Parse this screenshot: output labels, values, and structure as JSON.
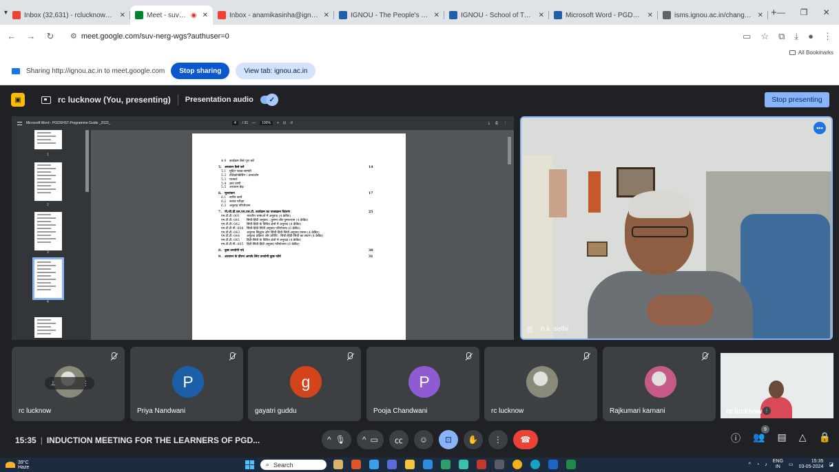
{
  "browser": {
    "tabs": [
      {
        "title": "Inbox (32,631) - rclucknow@ign",
        "icon": "gmail-icon",
        "color": "#ea4335",
        "active": false
      },
      {
        "title": "Meet - suv-nerg-wgs",
        "icon": "meet-icon",
        "color": "#00832d",
        "active": true
      },
      {
        "title": "Inbox - anamikasinha@ignou.ac",
        "icon": "gmail-icon",
        "color": "#ea4335",
        "active": false
      },
      {
        "title": "IGNOU - The People's Universit",
        "icon": "ignou-icon",
        "color": "#1e5fa8",
        "active": false
      },
      {
        "title": "IGNOU - School of Translation",
        "icon": "ignou-icon",
        "color": "#1e5fa8",
        "active": false
      },
      {
        "title": "Microsoft Word - PGDSHS",
        "icon": "ignou-icon",
        "color": "#1e5fa8",
        "active": false
      },
      {
        "title": "isms.ignou.ac.in/changeadmdet",
        "icon": "globe-icon",
        "color": "#5f6368",
        "active": false
      }
    ],
    "url": "meet.google.com/suv-nerg-wgs?authuser=0",
    "bookmarks_label": "All Bookmarks"
  },
  "share_banner": {
    "text": "Sharing http://ignou.ac.in to meet.google.com",
    "stop_label": "Stop sharing",
    "view_label": "View tab: ignou.ac.in"
  },
  "presenting": {
    "presenter": "rc lucknow (You, presenting)",
    "audio_label": "Presentation audio",
    "stop_label": "Stop presenting"
  },
  "document": {
    "title": "Microsoft Word - PGDSHST-Programme Guide _2022_",
    "page": "4",
    "pages": "/ 31",
    "zoom": "100%",
    "thumb_numbers": [
      "1",
      "2",
      "3",
      "4"
    ],
    "toc": [
      {
        "num": "4.9",
        "text": "कार्यक्रम कैसे पूरा करें",
        "page": "",
        "level": "sub"
      },
      {
        "num": "5.",
        "text": "अध्ययन कैसे करें",
        "page": "14",
        "level": "sec"
      },
      {
        "num": "5.1",
        "text": "मुद्रित पाठ्य-सामग्री",
        "page": "",
        "level": "sub"
      },
      {
        "num": "5.2",
        "text": "टेलिकॉन्फ्रेंसिंग / ज्ञानदर्शन",
        "page": "",
        "level": "sub"
      },
      {
        "num": "5.3",
        "text": "परामर्श",
        "page": "",
        "level": "sub"
      },
      {
        "num": "5.4",
        "text": "ज्ञान वाणी",
        "page": "",
        "level": "sub"
      },
      {
        "num": "5.5",
        "text": "अध्ययन केंद्र",
        "page": "",
        "level": "sub"
      },
      {
        "num": "6.",
        "text": "मूल्यांकन",
        "page": "17",
        "level": "sec"
      },
      {
        "num": "6.1",
        "text": "सत्रीय कार्य",
        "page": "",
        "level": "sub"
      },
      {
        "num": "6.2",
        "text": "सत्रांत परीक्षा",
        "page": "",
        "level": "sub"
      },
      {
        "num": "6.3",
        "text": "अनुवाद परियोजना",
        "page": "",
        "level": "sub"
      },
      {
        "num": "7.",
        "text": "पी.जी.डी.एस.एच.एस.टी. कार्यक्रम का पाठ्यक्रम विवरण",
        "page": "25",
        "level": "sec"
      },
      {
        "num": "एम.टी.टी.-001",
        "text": "भारतीय भाषाओं में अनुवाद (4 क्रेडिट)",
        "page": "",
        "level": "sub"
      },
      {
        "num": "एम.टी.टी.-041",
        "text": "सिंधी-हिंदी अनुवाद : तुलना और पुनरुत्थान (4 क्रेडिट)",
        "page": "",
        "level": "sub"
      },
      {
        "num": "एम.टी.टी.-042",
        "text": "सिंधी-हिंदी के विविध क्षेत्रों में अनुवाद (4 क्रेडिट)",
        "page": "",
        "level": "sub"
      },
      {
        "num": "एम.टी.टी.पी.-004",
        "text": "सिंधी-हिंदी-सिंधी अनुवाद परियोजना (6 क्रेडिट)",
        "page": "",
        "level": "sub"
      },
      {
        "num": "एम.टी.टी.-043",
        "text": "अनुवाद सिद्धांत और सिंधी-हिंदी-सिंधी अनुवाद प्रयास (4 क्रेडिट)",
        "page": "",
        "level": "sub"
      },
      {
        "num": "एम.टी.टी.-044",
        "text": "अनुवाद प्रक्रिया और प्रविधि : सिंधी-हिंदी-सिंधी का संदर्भ (4 क्रेडिट)",
        "page": "",
        "level": "sub"
      },
      {
        "num": "एम.टी.टी.-045",
        "text": "हिंदी-सिंधी के विविध क्षेत्रों में अनुवाद (4 क्रेडिट)",
        "page": "",
        "level": "sub"
      },
      {
        "num": "एम.टी.टी.पी.-005",
        "text": "हिंदी-सिंधी-हिंदी अनुवाद परियोजना (6 क्रेडिट)",
        "page": "",
        "level": "sub"
      },
      {
        "num": "8.",
        "text": "कुछ उपयोगी पते",
        "page": "30",
        "level": "sec"
      },
      {
        "num": "9.",
        "text": "अध्ययन के दौरान आपके लिए उपयोगी कुछ फॉर्म",
        "page": "31",
        "level": "sec"
      }
    ]
  },
  "main_video": {
    "name": "h.k. sethi"
  },
  "participants": [
    {
      "name": "rc lucknow",
      "initial": "",
      "color": "#8a8a7a",
      "photo": true,
      "pinned_overlay": true
    },
    {
      "name": "Priya Nandwani",
      "initial": "P",
      "color": "#1a5fa8",
      "photo": false,
      "pinned_overlay": false
    },
    {
      "name": "gayatri guddu",
      "initial": "g",
      "color": "#d4441c",
      "photo": false,
      "pinned_overlay": false
    },
    {
      "name": "Pooja Chandwani",
      "initial": "P",
      "color": "#8e5bd0",
      "photo": false,
      "pinned_overlay": false
    },
    {
      "name": "rc lucknow",
      "initial": "",
      "color": "#8a8a7a",
      "photo": true,
      "pinned_overlay": false
    },
    {
      "name": "Rajkumari karnani",
      "initial": "",
      "color": "#c65a86",
      "photo": true,
      "pinned_overlay": false
    }
  ],
  "self_tile": {
    "name": "rc lucknow"
  },
  "meeting": {
    "time": "15:35",
    "title": "INDUCTION MEETING FOR THE LEARNERS OF PGD...",
    "people_count": "9"
  },
  "taskbar": {
    "temp": "39°C",
    "weather": "Haze",
    "search_placeholder": "Search",
    "lang_top": "ENG",
    "lang_bottom": "IN",
    "time": "15:35",
    "date": "03-05-2024"
  }
}
